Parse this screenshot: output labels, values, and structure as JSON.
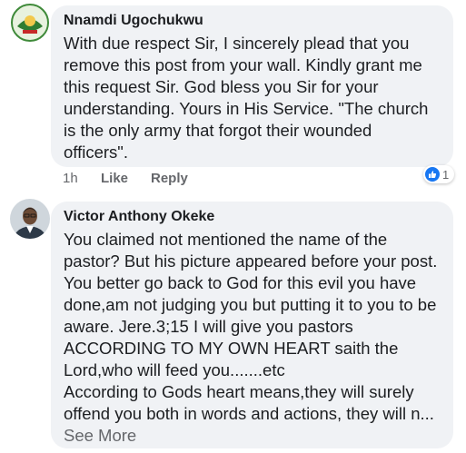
{
  "comments": [
    {
      "author": "Nnamdi Ugochukwu",
      "text": "With due respect Sir, I sincerely plead that you remove this post from your wall. Kindly grant me this request Sir. God bless you Sir for your understanding. Yours in His Service. \"The church is the only army that forgot their wounded officers\".",
      "time": "1h",
      "like_label": "Like",
      "reply_label": "Reply",
      "reaction_count": "1",
      "reaction_icon": "thumbs-up-icon"
    },
    {
      "author": "Victor Anthony Okeke",
      "text": "You claimed not mentioned the name of the pastor? But his picture appeared before your post. You better go back to God for this evil you have done,am not judging you but putting it to you to be aware. Jere.3;15 I will give you pastors ACCORDING TO MY OWN HEART saith the Lord,who will feed you.......etc",
      "text2": "According to Gods heart means,they will surely offend you both in words and actions, they will n...",
      "see_more": "See More"
    }
  ],
  "colors": {
    "bubble": "#f0f2f5",
    "accent": "#1877f2",
    "muted": "#65676b"
  }
}
